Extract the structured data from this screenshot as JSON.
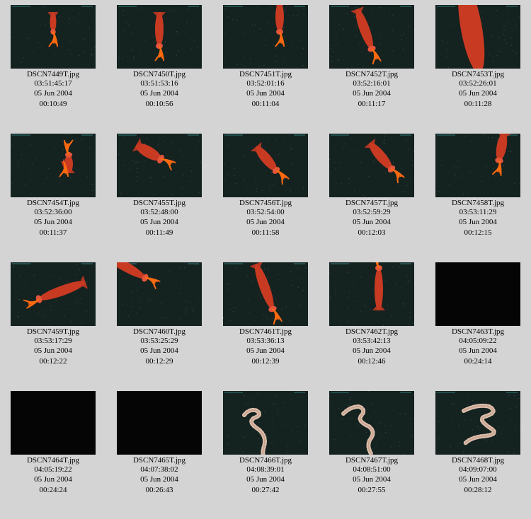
{
  "thumbnails": [
    {
      "file": "DSCN7449T.jpg",
      "time": "03:51:45:17",
      "date": "05 Jun 2004",
      "elapsed": "00:10:49",
      "subject": "squid",
      "dark": false
    },
    {
      "file": "DSCN7450T.jpg",
      "time": "03:51:53:16",
      "date": "05 Jun 2004",
      "elapsed": "00:10:56",
      "subject": "squid",
      "dark": false
    },
    {
      "file": "DSCN7451T.jpg",
      "time": "03:52:01:16",
      "date": "05 Jun 2004",
      "elapsed": "00:11:04",
      "subject": "squid",
      "dark": false
    },
    {
      "file": "DSCN7452T.jpg",
      "time": "03:52:16:01",
      "date": "05 Jun 2004",
      "elapsed": "00:11:17",
      "subject": "squid",
      "dark": false
    },
    {
      "file": "DSCN7453T.jpg",
      "time": "03:52:26:01",
      "date": "05 Jun 2004",
      "elapsed": "00:11:28",
      "subject": "squid",
      "dark": false
    },
    {
      "file": "DSCN7454T.jpg",
      "time": "03:52:36:00",
      "date": "05 Jun 2004",
      "elapsed": "00:11:37",
      "subject": "squid",
      "dark": false
    },
    {
      "file": "DSCN7455T.jpg",
      "time": "03:52:48:00",
      "date": "05 Jun 2004",
      "elapsed": "00:11:49",
      "subject": "squid",
      "dark": false
    },
    {
      "file": "DSCN7456T.jpg",
      "time": "03:52:54:00",
      "date": "05 Jun 2004",
      "elapsed": "00:11:58",
      "subject": "squid",
      "dark": false
    },
    {
      "file": "DSCN7457T.jpg",
      "time": "03:52:59:29",
      "date": "05 Jun 2004",
      "elapsed": "00:12:03",
      "subject": "squid",
      "dark": false
    },
    {
      "file": "DSCN7458T.jpg",
      "time": "03:53:11:29",
      "date": "05 Jun 2004",
      "elapsed": "00:12:15",
      "subject": "squid",
      "dark": false
    },
    {
      "file": "DSCN7459T.jpg",
      "time": "03:53:17:29",
      "date": "05 Jun 2004",
      "elapsed": "00:12:22",
      "subject": "squid",
      "dark": false
    },
    {
      "file": "DSCN7460T.jpg",
      "time": "03:53:25:29",
      "date": "05 Jun 2004",
      "elapsed": "00:12:29",
      "subject": "squid",
      "dark": false
    },
    {
      "file": "DSCN7461T.jpg",
      "time": "03:53:36:13",
      "date": "05 Jun 2004",
      "elapsed": "00:12:39",
      "subject": "squid",
      "dark": false
    },
    {
      "file": "DSCN7462T.jpg",
      "time": "03:53:42:13",
      "date": "05 Jun 2004",
      "elapsed": "00:12:46",
      "subject": "squid",
      "dark": false
    },
    {
      "file": "DSCN7463T.jpg",
      "time": "04:05:09:22",
      "date": "05 Jun 2004",
      "elapsed": "00:24:14",
      "subject": "none",
      "dark": true
    },
    {
      "file": "DSCN7464T.jpg",
      "time": "04:05:19:22",
      "date": "05 Jun 2004",
      "elapsed": "00:24:24",
      "subject": "none",
      "dark": true
    },
    {
      "file": "DSCN7465T.jpg",
      "time": "04:07:38:02",
      "date": "05 Jun 2004",
      "elapsed": "00:26:43",
      "subject": "none",
      "dark": true
    },
    {
      "file": "DSCN7466T.jpg",
      "time": "04:08:39:01",
      "date": "05 Jun 2004",
      "elapsed": "00:27:42",
      "subject": "egg-strand",
      "dark": false
    },
    {
      "file": "DSCN7467T.jpg",
      "time": "04:08:51:00",
      "date": "05 Jun 2004",
      "elapsed": "00:27:55",
      "subject": "egg-strand",
      "dark": false
    },
    {
      "file": "DSCN7468T.jpg",
      "time": "04:09:07:00",
      "date": "05 Jun 2004",
      "elapsed": "00:28:12",
      "subject": "egg-strand",
      "dark": false
    }
  ],
  "colors": {
    "page_background": "#d4d4d4",
    "water": "#142220",
    "squid_body": "#c83a22",
    "squid_arms": "#ff6a10",
    "egg_strand": "#e8c8b4"
  }
}
